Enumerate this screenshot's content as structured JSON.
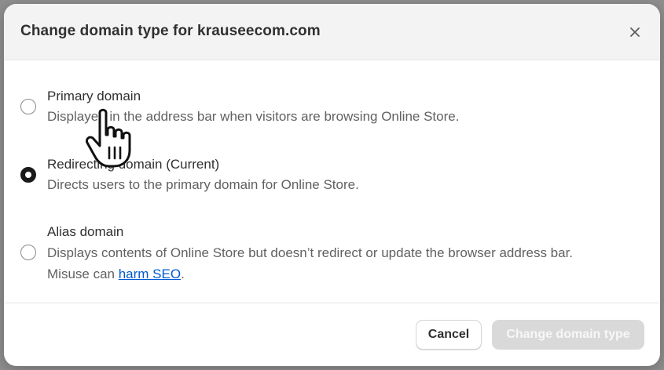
{
  "dialog": {
    "title": "Change domain type for krauseecom.com",
    "close_icon": "close-icon",
    "options": [
      {
        "label": "Primary domain",
        "description": "Displayed in the address bar when visitors are browsing Online Store.",
        "selected": false
      },
      {
        "label": "Redirecting domain (Current)",
        "description": "Directs users to the primary domain for Online Store.",
        "selected": true
      },
      {
        "label": "Alias domain",
        "description_line1": "Displays contents of Online Store but doesn’t redirect or update the browser address bar.",
        "description_line2_prefix": "Misuse can ",
        "description_link": "harm SEO",
        "description_line2_suffix": ".",
        "selected": false
      }
    ],
    "buttons": {
      "cancel": "Cancel",
      "submit": "Change domain type"
    }
  },
  "colors": {
    "link": "#005bd3",
    "disabled_button": "#d9d9d9",
    "header_bg": "#f3f3f3"
  },
  "cursor_icon": "hand-pointer-icon"
}
